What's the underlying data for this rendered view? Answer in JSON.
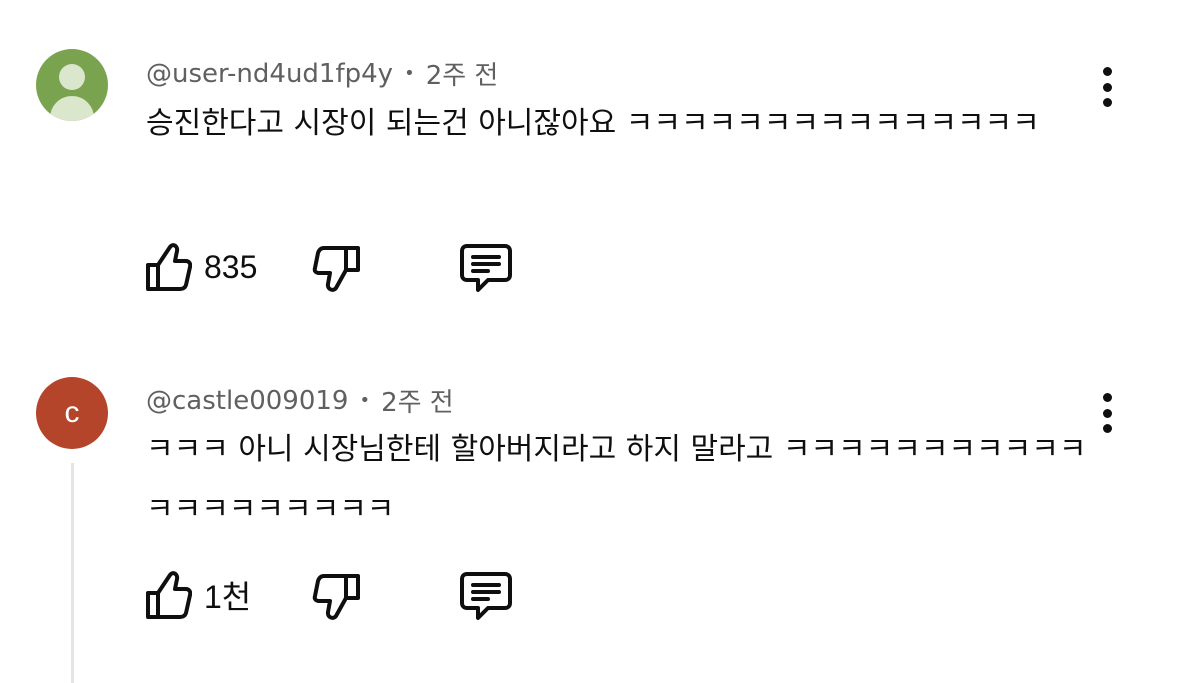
{
  "comments": [
    {
      "author": "@user-nd4ud1fp4y",
      "separator": "•",
      "time": "2주 전",
      "text": "승진한다고 시장이 되는건 아니잖아요 ㅋㅋㅋㅋㅋㅋㅋㅋㅋㅋㅋㅋㅋㅋㅋ",
      "likes": "835",
      "avatar": {
        "type": "default-person-icon",
        "color": "#7aa34f"
      }
    },
    {
      "author": "@castle009019",
      "separator": "•",
      "time": "2주 전",
      "text": "ㅋㅋㅋ 아니 시장님한테 할아버지라고 하지 말라고 ㅋㅋㅋㅋㅋㅋㅋㅋㅋㅋㅋㅋㅋㅋㅋㅋㅋㅋㅋㅋ",
      "likes": "1천",
      "avatar": {
        "type": "letter",
        "letter": "c",
        "color": "#b5452a"
      }
    }
  ],
  "colors": {
    "text": "#0f0f0f",
    "meta": "#606060",
    "thread_line": "#e5e5e5"
  },
  "icons": {
    "like": "thumbs-up-icon",
    "dislike": "thumbs-down-icon",
    "reply": "comment-icon",
    "menu": "more-vertical-icon"
  }
}
